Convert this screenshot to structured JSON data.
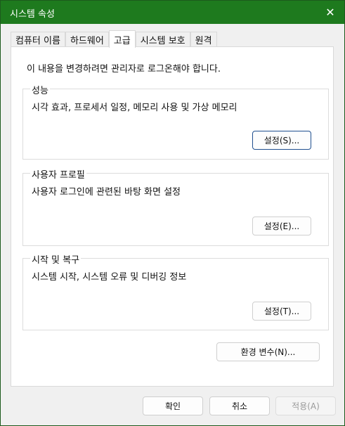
{
  "window": {
    "title": "시스템 속성",
    "close_glyph": "✕"
  },
  "tabs": [
    {
      "label": "컴퓨터 이름"
    },
    {
      "label": "하드웨어"
    },
    {
      "label": "고급"
    },
    {
      "label": "시스템 보호"
    },
    {
      "label": "원격"
    }
  ],
  "main": {
    "intro": "이 내용을 변경하려면 관리자로 로그온해야 합니다.",
    "performance": {
      "label": "성능",
      "desc": "시각 효과, 프로세서 일정, 메모리 사용 및 가상 메모리",
      "button": "설정(S)..."
    },
    "user_profile": {
      "label": "사용자 프로필",
      "desc": "사용자 로그인에 관련된 바탕 화면 설정",
      "button": "설정(E)..."
    },
    "startup_recovery": {
      "label": "시작 및 복구",
      "desc": "시스템 시작, 시스템 오류 및 디버깅 정보",
      "button": "설정(T)..."
    },
    "env_button": "환경 변수(N)..."
  },
  "footer": {
    "ok": "확인",
    "cancel": "취소",
    "apply": "적용(A)"
  },
  "colors": {
    "titlebar": "#1e7a1e",
    "focus_border": "#1f4f8f"
  }
}
